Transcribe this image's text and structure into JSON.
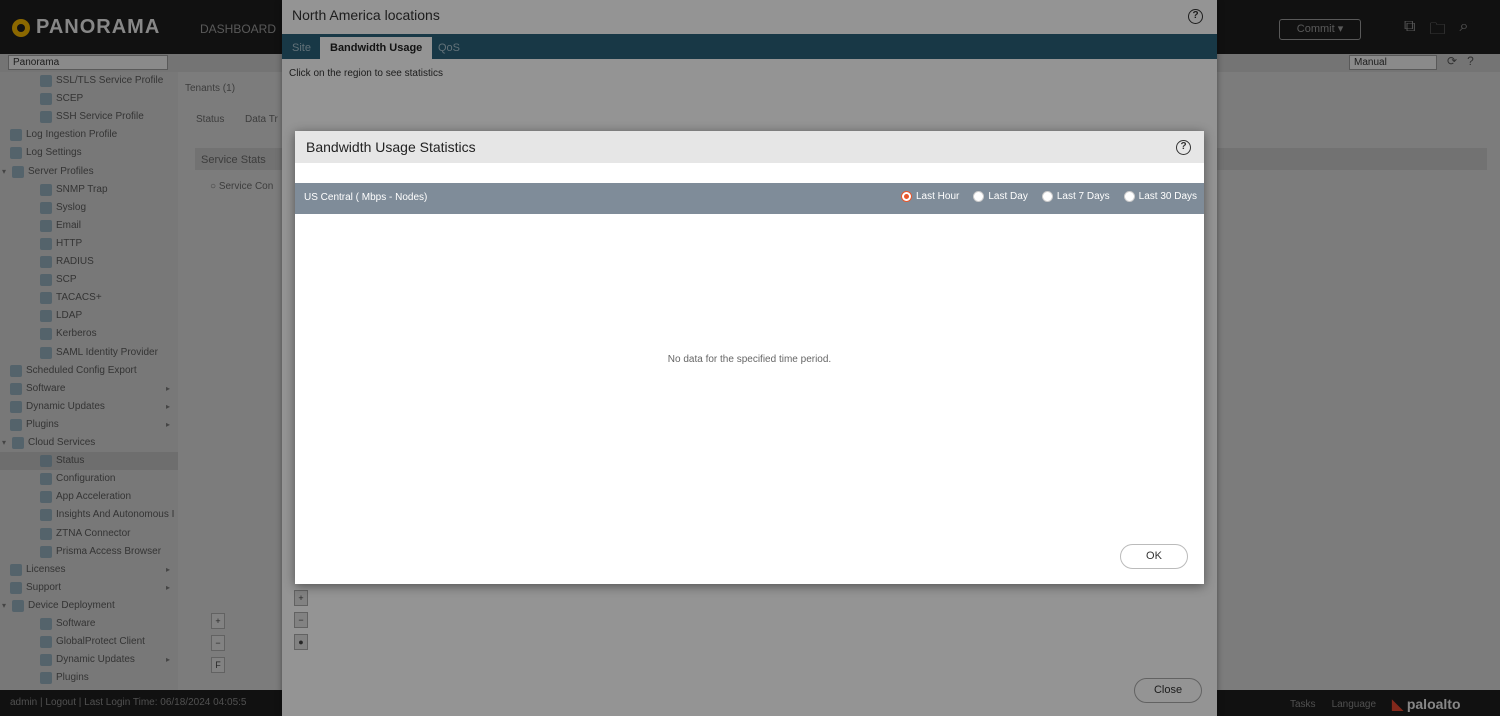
{
  "app": {
    "logo_text": "PANORAMA",
    "top_nav": "DASHBOARD",
    "commit_label": "Commit",
    "context_select": "Panorama",
    "mode_select": "Manual"
  },
  "background": {
    "tenants_label": "Tenants (1)",
    "tab_status": "Status",
    "tab_data": "Data Tr",
    "service_stats_header": "Service Stats",
    "service_conn_label": "Service Con"
  },
  "sidebar": {
    "items": [
      {
        "label": "SSL/TLS Service Profile",
        "level": 2
      },
      {
        "label": "SCEP",
        "level": 2
      },
      {
        "label": "SSH Service Profile",
        "level": 2
      },
      {
        "label": "Log Ingestion Profile",
        "level": 1
      },
      {
        "label": "Log Settings",
        "level": 1
      },
      {
        "label": "Server Profiles",
        "level": 1
      },
      {
        "label": "SNMP Trap",
        "level": 2
      },
      {
        "label": "Syslog",
        "level": 2
      },
      {
        "label": "Email",
        "level": 2
      },
      {
        "label": "HTTP",
        "level": 2
      },
      {
        "label": "RADIUS",
        "level": 2
      },
      {
        "label": "SCP",
        "level": 2
      },
      {
        "label": "TACACS+",
        "level": 2
      },
      {
        "label": "LDAP",
        "level": 2
      },
      {
        "label": "Kerberos",
        "level": 2
      },
      {
        "label": "SAML Identity Provider",
        "level": 2
      },
      {
        "label": "Scheduled Config Export",
        "level": 1
      },
      {
        "label": "Software",
        "level": 1
      },
      {
        "label": "Dynamic Updates",
        "level": 1
      },
      {
        "label": "Plugins",
        "level": 1
      },
      {
        "label": "Cloud Services",
        "level": 1
      },
      {
        "label": "Status",
        "level": 2
      },
      {
        "label": "Configuration",
        "level": 2
      },
      {
        "label": "App Acceleration",
        "level": 2
      },
      {
        "label": "Insights And Autonomous I",
        "level": 2
      },
      {
        "label": "ZTNA Connector",
        "level": 2
      },
      {
        "label": "Prisma Access Browser",
        "level": 2
      },
      {
        "label": "Licenses",
        "level": 1
      },
      {
        "label": "Support",
        "level": 1
      },
      {
        "label": "Device Deployment",
        "level": 1
      },
      {
        "label": "Software",
        "level": 2
      },
      {
        "label": "GlobalProtect Client",
        "level": 2
      },
      {
        "label": "Dynamic Updates",
        "level": 2
      },
      {
        "label": "Plugins",
        "level": 2
      }
    ]
  },
  "statusbar": {
    "left_text": "admin  |  Logout  |  Last Login Time: 06/18/2024 04:05:5",
    "tasks_label": "Tasks",
    "language_label": "Language",
    "brand": "paloalto"
  },
  "outer_dialog": {
    "title": "North America locations",
    "tabs": [
      "Site",
      "Bandwidth Usage",
      "QoS"
    ],
    "hint": "Click on the region to see statistics",
    "close_label": "Close"
  },
  "inner_dialog": {
    "title": "Bandwidth Usage Statistics",
    "region_label": "US Central ( Mbps - Nodes)",
    "time_options": [
      "Last Hour",
      "Last Day",
      "Last 7 Days",
      "Last 30 Days"
    ],
    "selected_option": "Last Hour",
    "empty_message": "No data for the specified time period.",
    "ok_label": "OK"
  },
  "icons": {
    "help": "?",
    "accent_color": "#e8572b",
    "tab_bar_color": "#2a6179"
  }
}
